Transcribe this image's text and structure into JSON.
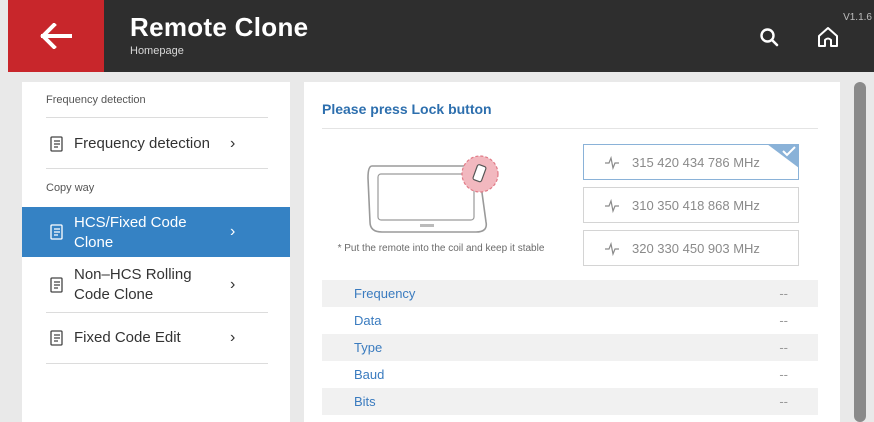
{
  "header": {
    "title": "Remote Clone",
    "subtitle": "Homepage",
    "version": "V1.1.6"
  },
  "sidebar": {
    "section_frequency": "Frequency detection",
    "section_copy": "Copy way",
    "items": [
      {
        "label": "Frequency detection",
        "icon": "file-icon"
      },
      {
        "label_line1": "HCS/Fixed Code",
        "label_line2": "Clone",
        "icon": "file-icon",
        "active": true
      },
      {
        "label_line1": "Non–HCS Rolling",
        "label_line2": "Code Clone",
        "icon": "file-icon"
      },
      {
        "label": "Fixed Code Edit",
        "icon": "file-icon"
      }
    ]
  },
  "main": {
    "prompt": "Please press Lock button",
    "coil_note": "* Put the remote into the coil and keep it stable",
    "frequency_options": [
      {
        "text": "315 420 434 786 MHz",
        "selected": true
      },
      {
        "text": "310 350 418 868 MHz",
        "selected": false
      },
      {
        "text": "320 330 450 903 MHz",
        "selected": false
      }
    ],
    "info": [
      {
        "key": "Frequency",
        "value": "--"
      },
      {
        "key": "Data",
        "value": "--"
      },
      {
        "key": "Type",
        "value": "--"
      },
      {
        "key": "Baud",
        "value": "--"
      },
      {
        "key": "Bits",
        "value": "--"
      }
    ]
  },
  "colors": {
    "accent_red": "#c8262b",
    "active_blue": "#3582c4",
    "header_dark": "#2e2e2e"
  }
}
